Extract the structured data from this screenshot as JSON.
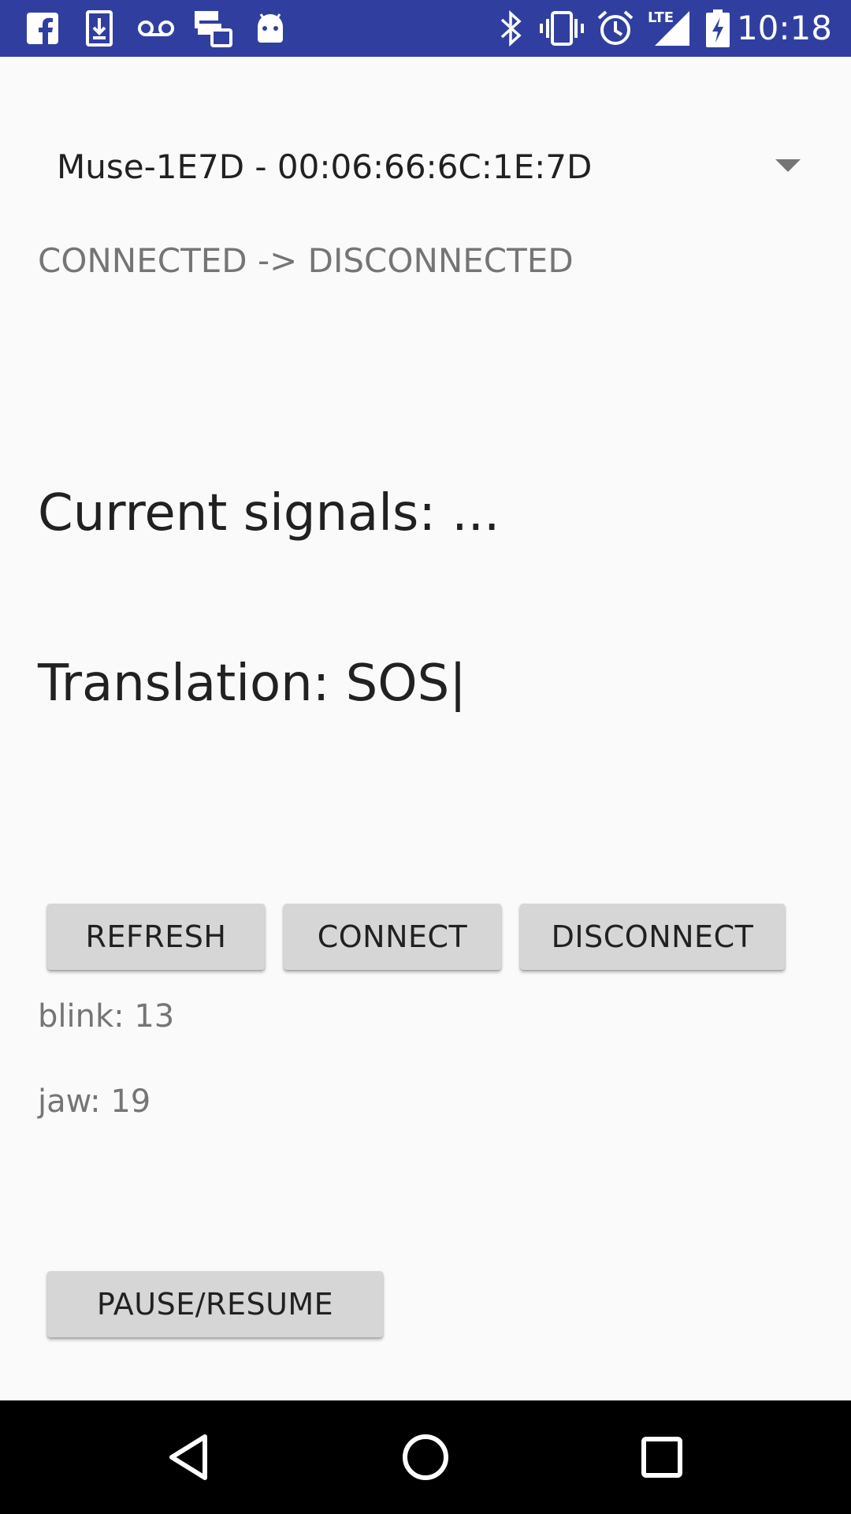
{
  "status_bar": {
    "time": "10:18",
    "network_label": "LTE",
    "icons_left": [
      "facebook-icon",
      "download-icon",
      "voicemail-icon",
      "message-icon",
      "android-icon"
    ],
    "icons_right": [
      "bluetooth-icon",
      "vibrate-icon",
      "alarm-icon",
      "signal-icon",
      "battery-charging-icon"
    ],
    "background_color": "#303f9f"
  },
  "spinner": {
    "selected": "Muse-1E7D - 00:06:66:6C:1E:7D"
  },
  "connection_status": "CONNECTED -> DISCONNECTED",
  "signals_text": "Current signals: ...",
  "translation_text": "Translation: SOS|",
  "buttons": {
    "refresh": "REFRESH",
    "connect": "CONNECT",
    "disconnect": "DISCONNECT",
    "pause_resume": "PAUSE/RESUME"
  },
  "counters": {
    "blink": "blink: 13",
    "jaw": "jaw: 19"
  },
  "nav_bar": {
    "icons": [
      "back-icon",
      "home-icon",
      "recents-icon"
    ]
  }
}
